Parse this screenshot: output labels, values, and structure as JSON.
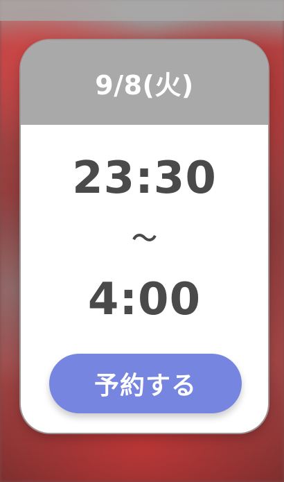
{
  "card": {
    "date": "9/8(火)",
    "start_time": "23:30",
    "separator": "〜",
    "end_time": "4:00",
    "reserve_button_label": "予約する"
  },
  "colors": {
    "header_bg": "#a9a9a9",
    "button_bg": "#7585e0",
    "text_dark": "#4a4a4a",
    "card_bg": "#ffffff"
  }
}
